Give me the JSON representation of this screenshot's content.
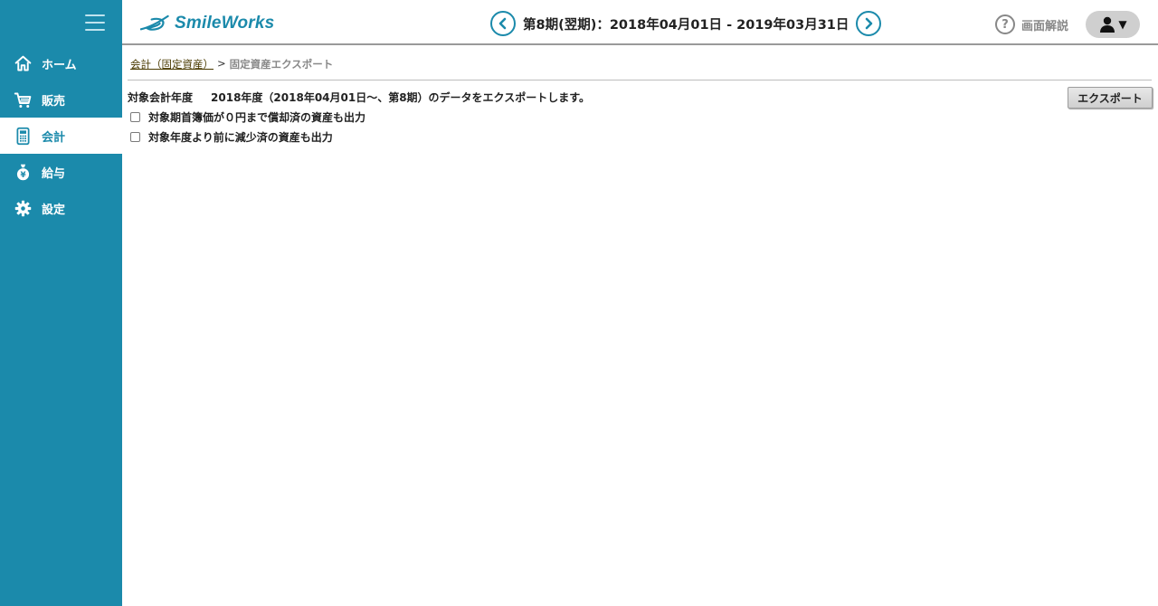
{
  "sidebar": {
    "items": [
      {
        "label": "ホーム",
        "icon": "home-icon",
        "active": false
      },
      {
        "label": "販売",
        "icon": "cart-icon",
        "active": false
      },
      {
        "label": "会計",
        "icon": "calculator-icon",
        "active": true
      },
      {
        "label": "給与",
        "icon": "money-bag-icon",
        "active": false
      },
      {
        "label": "設定",
        "icon": "gear-icon",
        "active": false
      }
    ]
  },
  "header": {
    "brand": "SmileWorks",
    "period": "第8期(翌期)：2018年04月01日 - 2019年03月31日",
    "help_label": "画面解説",
    "help_icon": "?"
  },
  "breadcrumb": {
    "parent": "会計（固定資産）",
    "separator": ">",
    "current": "固定資産エクスポート"
  },
  "content": {
    "target_label": "対象会計年度",
    "target_text": "2018年度（2018年04月01日〜、第8期）のデータをエクスポートします。",
    "export_button": "エクスポート",
    "options": [
      {
        "label": "対象期首簿価が０円まで償却済の資産も出力",
        "checked": false
      },
      {
        "label": "対象年度より前に減少済の資産も出力",
        "checked": false
      }
    ]
  },
  "colors": {
    "brand": "#1b8aab",
    "sidebar_bg": "#1b8aab",
    "active_bg": "#ffffff"
  }
}
